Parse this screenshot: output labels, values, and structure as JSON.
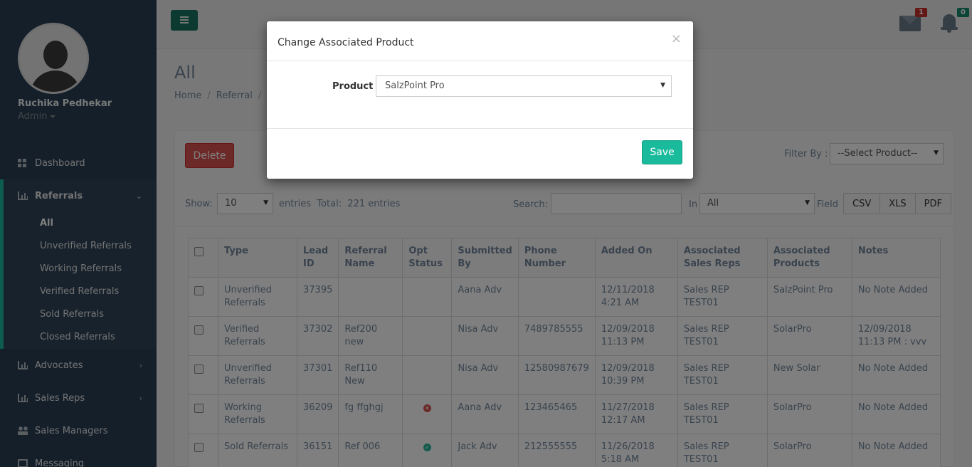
{
  "user": {
    "name": "Ruchika Pedhekar",
    "role": "Admin"
  },
  "sidebar": {
    "items": [
      {
        "label": "Dashboard"
      },
      {
        "label": "Referrals"
      },
      {
        "label": "Advocates"
      },
      {
        "label": "Sales Reps"
      },
      {
        "label": "Sales Managers"
      },
      {
        "label": "Messaging"
      }
    ],
    "referral_sub": [
      "All",
      "Unverified Referrals",
      "Working Referrals",
      "Verified Referrals",
      "Sold Referrals",
      "Closed Referrals"
    ]
  },
  "topnav": {
    "mail_count": "1",
    "notif_count": "0"
  },
  "page": {
    "title": "All",
    "breadcrumb": [
      "Home",
      "Referral"
    ]
  },
  "toolbar": {
    "delete_label": "Delete",
    "filter_label": "Filter By :",
    "filter_value": "--Select Product--",
    "show_label": "Show:",
    "show_value": "10",
    "entries_label": "entries  Total:  221 entries",
    "search_label": "Search:",
    "in_label": "In",
    "in_value": "All",
    "field_label": "Field",
    "export": [
      "CSV",
      "XLS",
      "PDF"
    ]
  },
  "table": {
    "headers": [
      "Type",
      "Lead ID",
      "Referral Name",
      "Opt Status",
      "Submitted By",
      "Phone Number",
      "Added On",
      "Associated Sales Reps",
      "Associated Products",
      "Notes"
    ],
    "rows": [
      [
        "Unverified Referrals",
        "37395",
        "",
        "",
        "Aana Adv",
        "",
        "12/11/2018 4:21 AM",
        "Sales REP TEST01",
        "SalzPoint Pro",
        "No Note Added"
      ],
      [
        "Verified Referrals",
        "37302",
        "Ref200 new",
        "",
        "Nisa Adv",
        "7489785555",
        "12/09/2018 11:13 PM",
        "Sales REP TEST01",
        "SolarPro",
        "12/09/2018 11:13 PM : vvv"
      ],
      [
        "Unverified Referrals",
        "37301",
        "Ref110 New",
        "",
        "Nisa Adv",
        "12580987679",
        "12/09/2018 10:39 PM",
        "Sales REP TEST01",
        "New Solar",
        "No Note Added"
      ],
      [
        "Working Referrals",
        "36209",
        "fg ffghgj",
        "",
        "Aana Adv",
        "123465465",
        "11/27/2018 12:17 AM",
        "Sales REP TEST01",
        "SolarPro",
        "No Note Added"
      ],
      [
        "Sold Referrals",
        "36151",
        "Ref 006",
        "",
        "Jack Adv",
        "212555555",
        "11/26/2018 5:18 AM",
        "Sales REP TEST01",
        "SolarPro",
        "No Note Added"
      ]
    ]
  },
  "modal": {
    "title": "Change Associated Product",
    "close": "×",
    "field_label": "Product",
    "product_value": "SalzPoint Pro",
    "save_label": "Save"
  }
}
